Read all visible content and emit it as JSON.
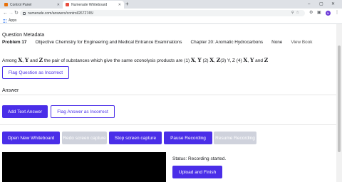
{
  "browser": {
    "tabs": [
      {
        "title": "Control Panel",
        "favicon_color": "#e8710a",
        "active": false
      },
      {
        "title": "Numerade Whiteboard",
        "favicon_color": "#e84c3d",
        "active": true
      }
    ],
    "new_tab_label": "+",
    "url": "numerade.com/answers/control/2672745/",
    "bookmarks": [
      {
        "label": "Apps"
      }
    ],
    "profile_initial": "N"
  },
  "page": {
    "metadata_title": "Question Metadata",
    "problem": "Problem 17",
    "book": "Objective Chemistry for Engineering and Medical Entrance Examinations",
    "chapter": "Chapter 20: Aromatic Hydrocarbons",
    "section": "None",
    "view_book": "View Book",
    "question": {
      "part1": "Among ",
      "X": "X",
      "sep1": ", ",
      "Y": "Y",
      "part2": " and ",
      "Z": "Z",
      "part3": " the pair of substances which give the same ozonolysis products are (1) ",
      "opt1a": "X",
      "opt1sep": ", ",
      "opt1b": "Y",
      "part4": " (2) ",
      "opt2a": "X",
      "opt2sep": ", ",
      "opt2b": "Z",
      "part5": "(3) Y, Z (4) ",
      "opt4a": "X",
      "opt4sep": ", ",
      "opt4b": "Y",
      "part6": " and ",
      "opt4c": "Z"
    },
    "flag_question": "Flag Question as Incorrect",
    "answer_title": "Answer",
    "add_text_answer": "Add Text Answer",
    "flag_answer": "Flag Answer as Incorrect",
    "controls": {
      "open_whiteboard": "Open New Whiteboard",
      "redo_capture": "Redo screen capture",
      "stop_capture": "Stop screen capture",
      "pause_recording": "Pause Recording",
      "resume_recording": "Resume Recording"
    },
    "status": "Status: Recording started.",
    "upload_finish": "Upload and Finish"
  },
  "colors": {
    "accent": "#4a2ee8",
    "disabled": "#cfd2dc"
  }
}
